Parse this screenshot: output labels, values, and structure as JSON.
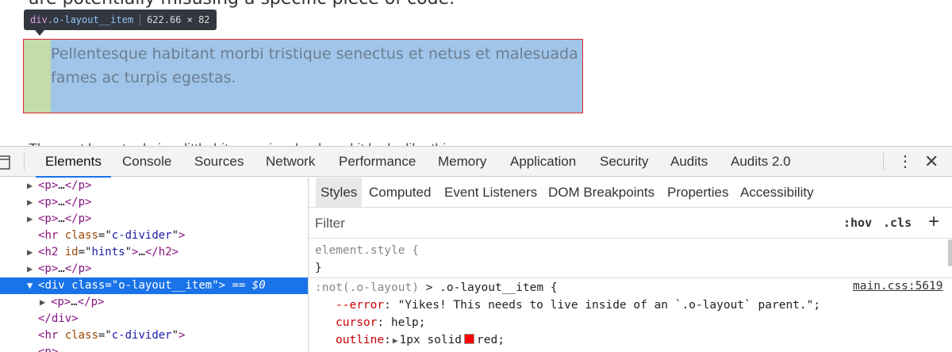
{
  "page": {
    "top_text": "are potentially misusing a specific piece of code.",
    "tooltip": {
      "tag": "div",
      "class_name": ".o-layout__item",
      "dimensions": "622.66 × 82"
    },
    "highlight_text": "Pellentesque habitant morbi tristique senectus et netus et malesuada fames ac turpis egestas.",
    "cut_text": "The next layout rule is a little bit more involved, and it looks like this:"
  },
  "devtools": {
    "tabs": [
      "Elements",
      "Console",
      "Sources",
      "Network",
      "Performance",
      "Memory",
      "Application",
      "Security",
      "Audits",
      "Audits 2.0"
    ],
    "active_tab": "Elements",
    "tree": [
      {
        "caret": "▶",
        "open": "<p>",
        "dots": "…",
        "close": "</p>"
      },
      {
        "caret": "▶",
        "open": "<p>",
        "dots": "…",
        "close": "</p>"
      },
      {
        "caret": "▶",
        "open": "<p>",
        "dots": "…",
        "close": "</p>"
      },
      {
        "tag": "hr",
        "attr": "class",
        "value": "c-divider"
      },
      {
        "caret": "▶",
        "tag": "h2",
        "attr": "id",
        "value": "hints",
        "dots": "…",
        "close": "</h2>"
      },
      {
        "caret": "▶",
        "open": "<p>",
        "dots": "…",
        "close": "</p>"
      },
      {
        "caret": "▼",
        "tag": "div",
        "attr": "class",
        "value": "o-layout__item",
        "suffix": " == $0",
        "selected": true
      },
      {
        "caret": "▶",
        "open": "<p>",
        "dots": "…",
        "close": "</p>"
      },
      {
        "close_only": "</div>"
      },
      {
        "tag": "hr",
        "attr": "class",
        "value": "c-divider"
      },
      {
        "open": "<p>",
        "dots": "…"
      }
    ],
    "styles": {
      "subtabs": [
        "Styles",
        "Computed",
        "Event Listeners",
        "DOM Breakpoints",
        "Properties",
        "Accessibility"
      ],
      "active_subtab": "Styles",
      "filter_placeholder": "Filter",
      "hov_label": ":hov",
      "cls_label": ".cls",
      "add_label": "+",
      "element_style_selector": "element.style {",
      "close_brace": "}",
      "rule_selector_gray": ":not(.o-layout)",
      "rule_selector_rest": " > .o-layout__item {",
      "rule_source": "main.css:5619",
      "declarations": [
        {
          "prop": "--error",
          "value": "\"Yikes! This needs to live inside of an `.o-layout` parent.\";"
        },
        {
          "prop": "cursor",
          "value": "help;"
        },
        {
          "prop": "outline",
          "value_pre": "1px solid",
          "value_post": "red;"
        }
      ]
    }
  }
}
